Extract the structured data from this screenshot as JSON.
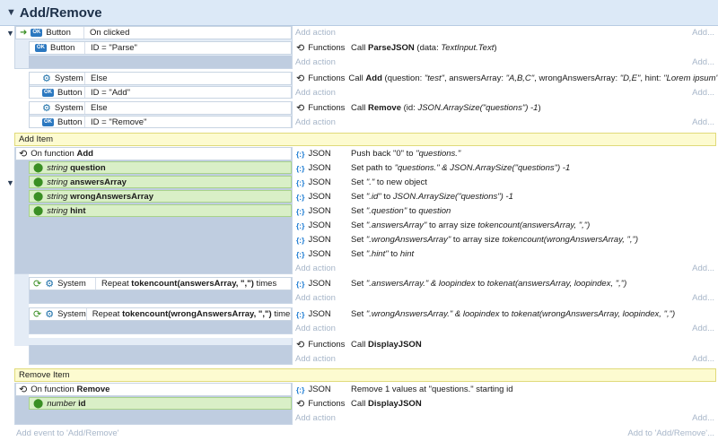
{
  "sheet_title": "Add/Remove",
  "add_action": "Add action",
  "add_dots": "Add...",
  "footer": {
    "left": "Add event to 'Add/Remove'",
    "right": "Add to 'Add/Remove'..."
  },
  "ev1": {
    "object": "Button",
    "condition": "On clicked",
    "c2_obj": "Button",
    "c2_text": "ID = \"Parse\"",
    "a_obj": "Functions",
    "a_call": "Call",
    "a_fn": "ParseJSON",
    "a_args_pre": "(data: ",
    "a_args_it": "TextInput.Text",
    "a_args_post": ")"
  },
  "ev2": {
    "obj": "System",
    "cond": "Else",
    "c2_obj": "Button",
    "c2_text": "ID = \"Add\"",
    "a_obj": "Functions",
    "a_call": "Call",
    "a_fn": "Add",
    "a_args_pre": "(question: ",
    "q": "\"test\"",
    "a_mid1": ", answersArray: ",
    "aa": "\"A,B,C\"",
    "a_mid2": ", wrongAnswersArray: ",
    "wa": "\"D,E\"",
    "a_mid3": ", hint: ",
    "h": "\"Lorem ipsum\"",
    "a_args_post": ")"
  },
  "ev3": {
    "obj": "System",
    "cond": "Else",
    "c2_obj": "Button",
    "c2_text": "ID = \"Remove\"",
    "a_obj": "Functions",
    "a_call": "Call",
    "a_fn": "Remove",
    "a_args_pre": "(id: ",
    "a_args_it": "JSON.ArraySize(\"questions\") -1",
    "a_args_post": ")"
  },
  "group_add": "Add Item",
  "fn_add": {
    "label": "On function",
    "name": "Add",
    "params": [
      {
        "type": "string",
        "name": "question"
      },
      {
        "type": "string",
        "name": "answersArray"
      },
      {
        "type": "string",
        "name": "wrongAnswersArray"
      },
      {
        "type": "string",
        "name": "hint"
      }
    ],
    "actions": [
      {
        "obj": "JSON",
        "pre": "Push back \"0\" to ",
        "it": "\"questions.\"",
        "post": ""
      },
      {
        "obj": "JSON",
        "pre": "Set path to ",
        "it": "\"questions.\" & JSON.ArraySize(\"questions\") -1",
        "post": ""
      },
      {
        "obj": "JSON",
        "pre": "Set ",
        "it": "\".\"",
        "post": " to new object"
      },
      {
        "obj": "JSON",
        "pre": "Set ",
        "it": "\".id\"",
        "post": " to ",
        "it2": "JSON.ArraySize(\"questions\") -1"
      },
      {
        "obj": "JSON",
        "pre": "Set ",
        "it": "\".question\"",
        "post": " to ",
        "it2": "question"
      },
      {
        "obj": "JSON",
        "pre": "Set ",
        "it": "\".answersArray\"",
        "post": " to array size ",
        "it2": "tokencount(answersArray, \",\")"
      },
      {
        "obj": "JSON",
        "pre": "Set ",
        "it": "\".wrongAnswersArray\"",
        "post": " to array size ",
        "it2": "tokencount(wrongAnswersArray, \",\")"
      },
      {
        "obj": "JSON",
        "pre": "Set ",
        "it": "\".hint\"",
        "post": " to ",
        "it2": "hint"
      }
    ]
  },
  "rep1": {
    "obj": "System",
    "pre": "Repeat ",
    "b": "tokencount(answersArray, \",\")",
    "post": " times",
    "a_obj": "JSON",
    "a_pre": "Set ",
    "a_it": "\".answersArray.\" & loopindex",
    "a_mid": " to ",
    "a_it2": "tokenat(answersArray, loopindex, \",\")"
  },
  "rep2": {
    "obj": "System",
    "pre": "Repeat ",
    "b": "tokencount(wrongAnswersArray, \",\")",
    "post": " times",
    "a_obj": "JSON",
    "a_pre": "Set ",
    "a_it": "\".wrongAnswersArray.\" & loopindex",
    "a_mid": " to ",
    "a_it2": "tokenat(wrongAnswersArray, loopindex, \",\")"
  },
  "ev_display1": {
    "a_obj": "Functions",
    "a_call": "Call",
    "a_fn": "DisplayJSON"
  },
  "group_remove": "Remove Item",
  "fn_remove": {
    "label": "On function",
    "name": "Remove",
    "param_type": "number",
    "param_name": "id",
    "a1_obj": "JSON",
    "a1_text": "Remove 1 values at \"questions.\" starting id",
    "a2_obj": "Functions",
    "a2_call": "Call",
    "a2_fn": "DisplayJSON"
  },
  "accent_colors": {
    "title_bar": "#dce9f7",
    "group": "#fdfbd0",
    "param": "#d9efc7",
    "event": "#e4ecf6"
  }
}
